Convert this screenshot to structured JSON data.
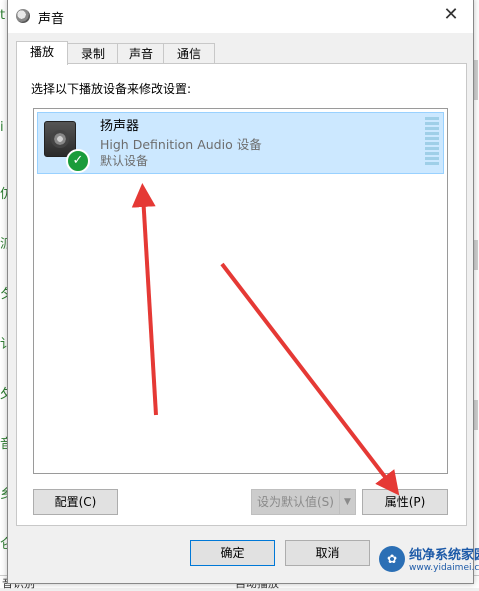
{
  "window": {
    "title": "声音",
    "close_glyph": "✕"
  },
  "tabs": [
    {
      "label": "播放",
      "active": true
    },
    {
      "label": "录制",
      "active": false
    },
    {
      "label": "声音",
      "active": false
    },
    {
      "label": "通信",
      "active": false
    }
  ],
  "playback": {
    "instruction": "选择以下播放设备来修改设置:",
    "devices": [
      {
        "name": "扬声器",
        "description": "High Definition Audio 设备",
        "status": "默认设备",
        "icon": "speaker-icon",
        "selected": true
      }
    ]
  },
  "buttons": {
    "configure": "配置(C)",
    "set_default": "设为默认值(S)",
    "set_default_arrow": "▼",
    "properties": "属性(P)",
    "ok": "确定",
    "cancel": "取消"
  },
  "background_app": {
    "left_glyphs": [
      "t",
      "i",
      "仿",
      "派",
      "夕",
      "讠",
      "夂",
      "音",
      "乡",
      "仑"
    ],
    "bottom_left": "音识别",
    "bottom_right": "自动播放"
  },
  "watermark": {
    "title": "纯净系统家园",
    "url": "www.yidaimei.com"
  },
  "colors": {
    "selection": "#cce8ff",
    "check": "#1a9c3a",
    "annotation_arrow": "#e53935"
  }
}
